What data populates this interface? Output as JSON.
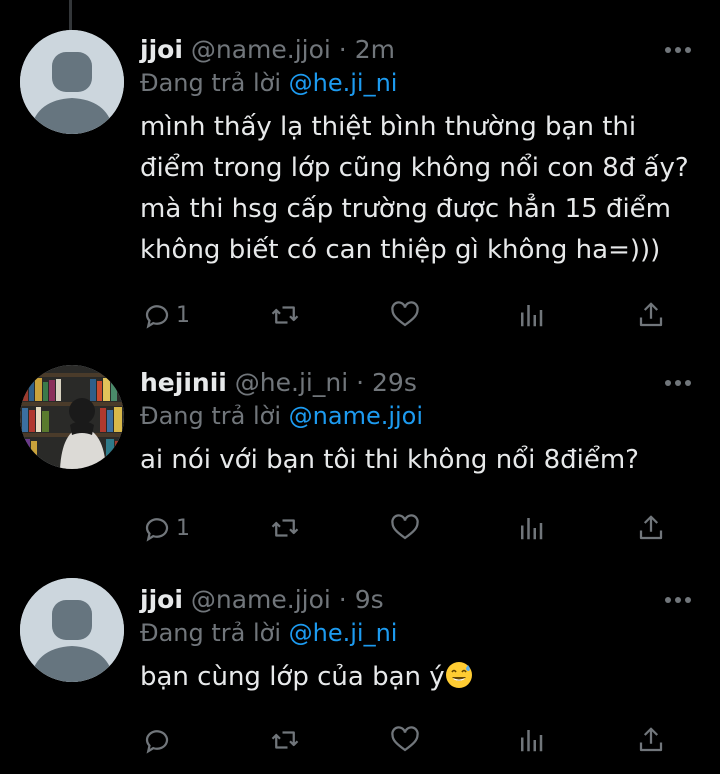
{
  "tweets": [
    {
      "name": "jjoi",
      "handle": "@name.jjoi",
      "sep": "·",
      "time": "2m",
      "reply_prefix": "Đang trả lời",
      "reply_to": "@he.ji_ni",
      "lines": [
        "mình thấy lạ thiệt bình thường bạn thi",
        "điểm trong lớp cũng không nổi con 8đ ấy?",
        "mà thi hsg cấp trường được hẳn 15 điểm",
        "không biết có can thiệp gì không ha=)))"
      ],
      "reply_count": "1",
      "avatar": "default-avatar-icon"
    },
    {
      "name": "hejinii",
      "handle": "@he.ji_ni",
      "sep": "·",
      "time": "29s",
      "reply_prefix": "Đang trả lời",
      "reply_to": "@name.jjoi",
      "lines": [
        "ai nói với bạn tôi thi không nổi 8điểm?"
      ],
      "reply_count": "1",
      "avatar": "bookshelf-photo-avatar"
    },
    {
      "name": "jjoi",
      "handle": "@name.jjoi",
      "sep": "·",
      "time": "9s",
      "reply_prefix": "Đang trả lời",
      "reply_to": "@he.ji_ni",
      "lines": [
        "bạn cùng lớp của bạn ý"
      ],
      "emoji": "sweat-smile-emoji",
      "reply_count": "",
      "avatar": "default-avatar-icon"
    }
  ],
  "colors": {
    "background": "#000000",
    "text": "#e7e9ea",
    "muted": "#71767b",
    "accent": "#1d9bf0"
  }
}
